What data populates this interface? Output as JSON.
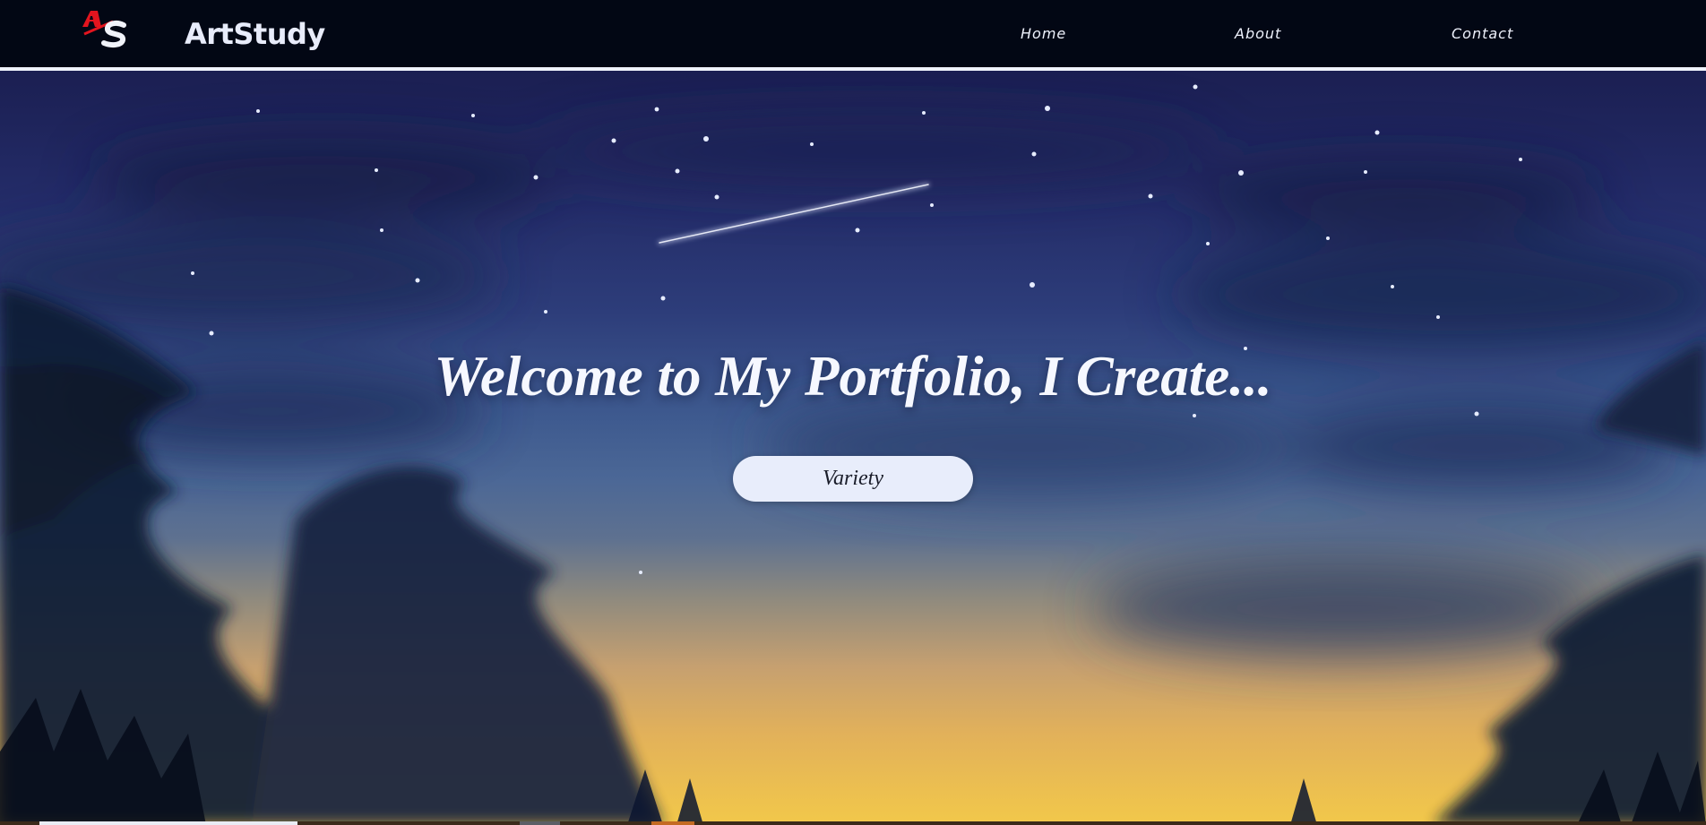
{
  "nav": {
    "brand": "ArtStudy",
    "links": [
      {
        "label": "Home"
      },
      {
        "label": "About"
      },
      {
        "label": "Contact"
      }
    ]
  },
  "hero": {
    "title": "Welcome to My Portfolio, I Create...",
    "button_label": "Variety"
  },
  "colors": {
    "nav_bg": "#020714",
    "logo_red": "#e3141e",
    "sky_top": "#1b1f52",
    "sunset": "#f2c84a",
    "button_bg": "#e8edfb"
  },
  "icons": {
    "logo": "as-monogram-logo"
  }
}
